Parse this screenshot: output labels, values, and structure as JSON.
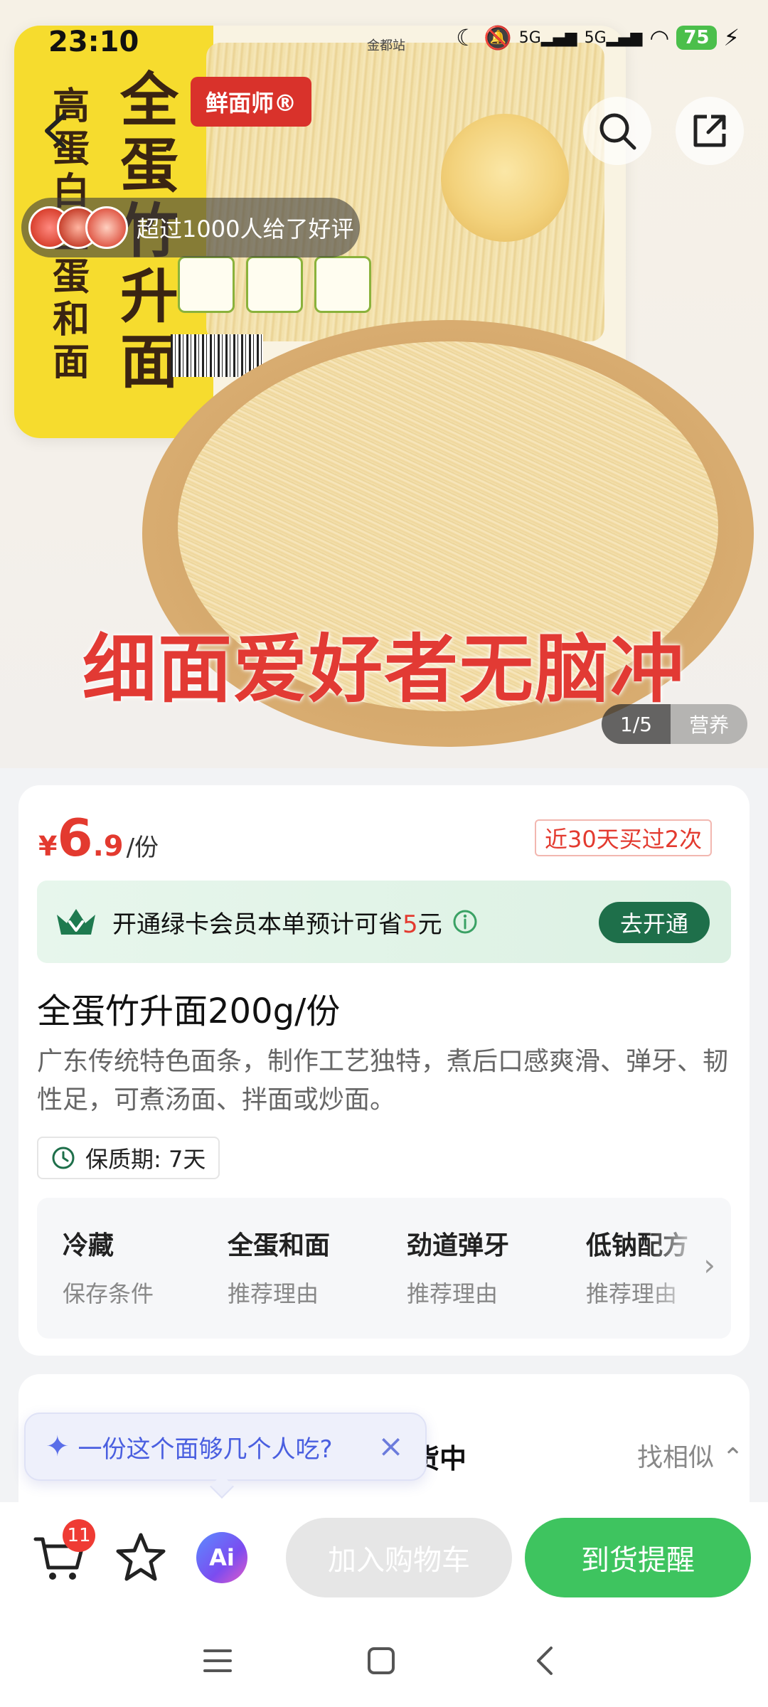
{
  "status_bar": {
    "time": "23:10",
    "carrier_label": "金都站",
    "network_1": "5G",
    "network_2": "5G",
    "battery": "75"
  },
  "hero": {
    "brand": "鲜面师®",
    "pack_title": "全蛋竹升面",
    "pack_side": "高蛋白全蛋和面",
    "caption": "细面爱好者无脑冲",
    "review_text": "超过1000人给了好评",
    "pager_count": "1/5",
    "pager_tag": "营养"
  },
  "product": {
    "price_symbol": "¥",
    "price_int": "6",
    "price_dec": ".9",
    "price_unit": "/份",
    "bought_tag": "近30天买过2次",
    "member_text_pre": "开通绿卡会员本单预计可省",
    "member_save": "5",
    "member_text_post": "元",
    "member_button": "去开通",
    "title": "全蛋竹升面200g/份",
    "description": "广东传统特色面条，制作工艺独特，煮后口感爽滑、弹牙、韧性足，可煮汤面、拌面或炒面。",
    "shelf_life": "保质期: 7天",
    "attributes": [
      {
        "value": "冷藏",
        "key": "保存条件"
      },
      {
        "value": "全蛋和面",
        "key": "推荐理由"
      },
      {
        "value": "劲道弹牙",
        "key": "推荐理由"
      },
      {
        "value": "低钠配方",
        "key": "推荐理由"
      }
    ]
  },
  "stock_section": {
    "status": "货中",
    "find_similar": "找相似"
  },
  "ai_bubble": {
    "question": "一份这个面够几个人吃?"
  },
  "actions": {
    "cart_count": "11",
    "ai_label": "Ai",
    "add_to_cart": "加入购物车",
    "notify": "到货提醒"
  },
  "colors": {
    "price_red": "#e33a2f",
    "member_green": "#1e6f4a",
    "notify_green": "#3ec45f",
    "disabled_gray": "#e6e6e6"
  }
}
